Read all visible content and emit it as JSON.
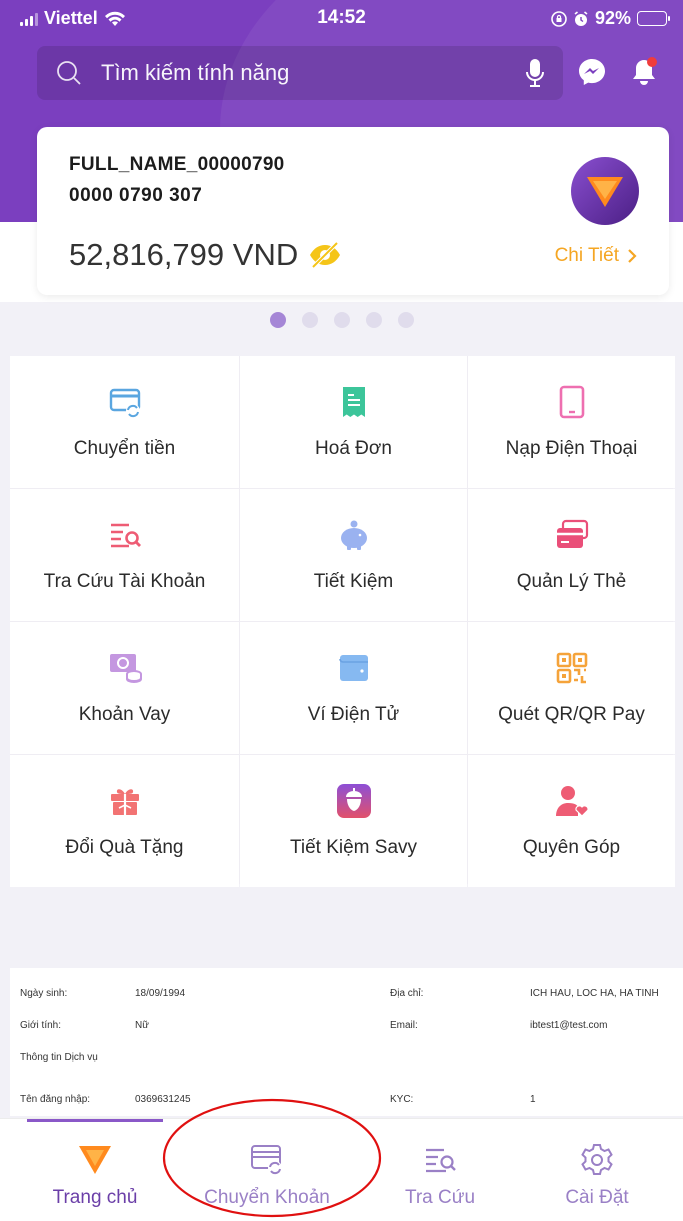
{
  "status_bar": {
    "carrier": "Viettel",
    "time": "14:52",
    "battery": "92%",
    "battery_level": 0.92
  },
  "search": {
    "placeholder": "Tìm kiếm tính năng"
  },
  "account_card": {
    "name": "FULL_NAME_00000790",
    "account_number": "0000 0790 307",
    "balance": "52,816,799 VND",
    "detail_label": "Chi Tiết"
  },
  "carousel": {
    "total": 5,
    "active_index": 0
  },
  "services": [
    {
      "label": "Chuyển tiền",
      "icon": "transfer-card-icon",
      "color": "#5aa6e0"
    },
    {
      "label": "Hoá Đơn",
      "icon": "receipt-icon",
      "color": "#3cc59a"
    },
    {
      "label": "Nạp Điện Thoại",
      "icon": "phone-icon",
      "color": "#ee6fb0"
    },
    {
      "label": "Tra Cứu Tài Khoản",
      "icon": "account-lookup-icon",
      "color": "#ee5c74"
    },
    {
      "label": "Tiết Kiệm",
      "icon": "piggy-bank-icon",
      "color": "#9ab2f0"
    },
    {
      "label": "Quản Lý Thẻ",
      "icon": "card-manage-icon",
      "color": "#ea4f79"
    },
    {
      "label": "Khoản Vay",
      "icon": "loan-icon",
      "color": "#c497e0"
    },
    {
      "label": "Ví Điện Tử",
      "icon": "wallet-icon",
      "color": "#86b9f1"
    },
    {
      "label": "Quét QR/QR Pay",
      "icon": "qr-code-icon",
      "color": "#f5a33a"
    },
    {
      "label": "Đổi Quà Tặng",
      "icon": "gift-icon",
      "color": "#f27373"
    },
    {
      "label": "Tiết Kiệm Savy",
      "icon": "savy-acorn-icon",
      "color": "#7a3fbf"
    },
    {
      "label": "Quyên Góp",
      "icon": "donate-icon",
      "color": "#ee5c74"
    }
  ],
  "info": {
    "dob_label": "Ngày sinh:",
    "dob": "18/09/1994",
    "address_label": "Địa chỉ:",
    "address": "ICH HAU, LOC HA, HA TINH",
    "gender_label": "Giới tính:",
    "gender": "Nữ",
    "email_label": "Email:",
    "email": "ibtest1@test.com",
    "service_info": "Thông tin Dịch vụ",
    "username_label": "Tên đăng nhập:",
    "username": "0369631245",
    "kyc_label": "KYC:",
    "kyc": "1"
  },
  "tabbar": [
    {
      "label": "Trang chủ",
      "icon": "home-logo-icon",
      "active": true
    },
    {
      "label": "Chuyển Khoản",
      "icon": "transfer-icon",
      "active": false
    },
    {
      "label": "Tra Cứu",
      "icon": "lookup-icon",
      "active": false
    },
    {
      "label": "Cài Đặt",
      "icon": "settings-gear-icon",
      "active": false
    }
  ],
  "colors": {
    "brand_purple": "#7b3fbf",
    "accent_orange": "#f5a623",
    "annotation_red": "#e01010"
  }
}
